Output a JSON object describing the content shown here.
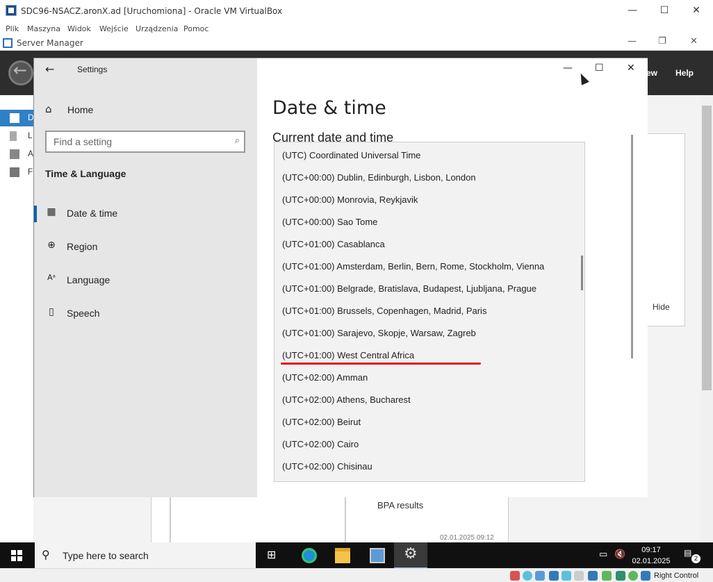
{
  "vbox": {
    "title": "SDC96-NSACZ.aronX.ad [Uruchomiona] - Oracle VM VirtualBox",
    "menu": [
      "Plik",
      "Maszyna",
      "Widok",
      "Wejście",
      "Urządzenia",
      "Pomoc"
    ],
    "status_host_key": "Right Control"
  },
  "server_manager": {
    "title": "Server Manager",
    "header_view": "ew",
    "header_help": "Help",
    "sidebar_letters": [
      "D",
      "L",
      "A",
      "F"
    ],
    "hide_label": "Hide",
    "bpa_label": "BPA results",
    "bpa_date": "02.01.2025 09:12"
  },
  "settings": {
    "window_title": "Settings",
    "home_label": "Home",
    "search_placeholder": "Find a setting",
    "section_title": "Time & Language",
    "nav": [
      {
        "label": "Date & time",
        "icon": "calendar-clock-icon",
        "selected": true
      },
      {
        "label": "Region",
        "icon": "globe-icon",
        "selected": false
      },
      {
        "label": "Language",
        "icon": "language-icon",
        "selected": false
      },
      {
        "label": "Speech",
        "icon": "microphone-icon",
        "selected": false
      }
    ],
    "page_title": "Date & time",
    "subheading": "Current date and time"
  },
  "timezones": [
    "(UTC) Coordinated Universal Time",
    "(UTC+00:00) Dublin, Edinburgh, Lisbon, London",
    "(UTC+00:00) Monrovia, Reykjavik",
    "(UTC+00:00) Sao Tome",
    "(UTC+01:00) Casablanca",
    "(UTC+01:00) Amsterdam, Berlin, Bern, Rome, Stockholm, Vienna",
    "(UTC+01:00) Belgrade, Bratislava, Budapest, Ljubljana, Prague",
    "(UTC+01:00) Brussels, Copenhagen, Madrid, Paris",
    "(UTC+01:00) Sarajevo, Skopje, Warsaw, Zagreb",
    "(UTC+01:00) West Central Africa",
    "(UTC+02:00) Amman",
    "(UTC+02:00) Athens, Bucharest",
    "(UTC+02:00) Beirut",
    "(UTC+02:00) Cairo",
    "(UTC+02:00) Chisinau"
  ],
  "highlighted_timezone": "(UTC+01:00) Sarajevo, Skopje, Warsaw, Zagreb",
  "taskbar": {
    "search_placeholder": "Type here to search",
    "time": "09:17",
    "date": "02.01.2025",
    "notification_count": "2"
  },
  "colors": {
    "accent": "#0063b1",
    "highlight_underline": "#e0101a",
    "taskbar": "#101010"
  }
}
